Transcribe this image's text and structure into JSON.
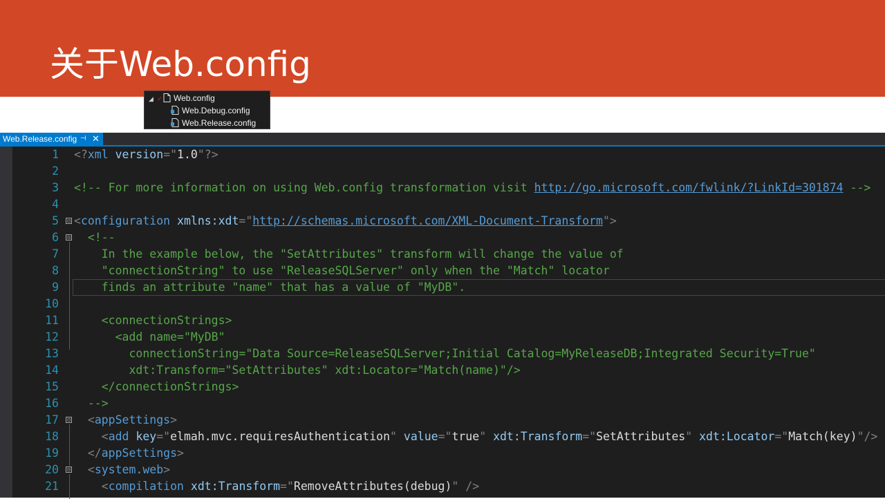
{
  "slide": {
    "title": "关于Web.config"
  },
  "solution_tree": {
    "items": [
      {
        "label": "Web.config",
        "expander": "◢",
        "check": "✓",
        "icon": "config-file-icon"
      },
      {
        "label": "Web.Debug.config",
        "icon": "config-file-icon"
      },
      {
        "label": "Web.Release.config",
        "icon": "config-file-icon"
      }
    ]
  },
  "editor": {
    "tab": {
      "label": "Web.Release.config",
      "pin": "⊣",
      "close": "✕"
    },
    "lines": [
      {
        "n": "1",
        "fold": "",
        "segs": [
          [
            "brk",
            "<?"
          ],
          [
            "tag",
            "xml "
          ],
          [
            "attr",
            "version"
          ],
          [
            "brk",
            "=\""
          ],
          [
            "plain",
            "1.0"
          ],
          [
            "brk",
            "\"?>"
          ]
        ]
      },
      {
        "n": "2",
        "fold": "",
        "segs": []
      },
      {
        "n": "3",
        "fold": "",
        "segs": [
          [
            "com",
            "<!-- For more information on using Web.config transformation visit "
          ],
          [
            "url",
            "http://go.microsoft.com/fwlink/?LinkId=301874"
          ],
          [
            "com",
            " -->"
          ]
        ]
      },
      {
        "n": "4",
        "fold": "",
        "segs": []
      },
      {
        "n": "5",
        "fold": "⊟",
        "segs": [
          [
            "brk",
            "<"
          ],
          [
            "tag",
            "configuration "
          ],
          [
            "attr",
            "xmlns:xdt"
          ],
          [
            "brk",
            "=\""
          ],
          [
            "url",
            "http://schemas.microsoft.com/XML-Document-Transform"
          ],
          [
            "brk",
            "\">"
          ]
        ]
      },
      {
        "n": "6",
        "fold": "⊟",
        "segs": [
          [
            "plain",
            "  "
          ],
          [
            "com",
            "<!--"
          ]
        ]
      },
      {
        "n": "7",
        "fold": "",
        "segs": [
          [
            "com",
            "    In the example below, the \"SetAttributes\" transform will change the value of"
          ]
        ]
      },
      {
        "n": "8",
        "fold": "",
        "segs": [
          [
            "com",
            "    \"connectionString\" to use \"ReleaseSQLServer\" only when the \"Match\" locator"
          ]
        ]
      },
      {
        "n": "9",
        "fold": "",
        "segs": [
          [
            "com",
            "    finds an attribute \"name\" that has a value of \"MyDB\"."
          ]
        ]
      },
      {
        "n": "10",
        "fold": "",
        "segs": []
      },
      {
        "n": "11",
        "fold": "",
        "segs": [
          [
            "com",
            "    <connectionStrings>"
          ]
        ]
      },
      {
        "n": "12",
        "fold": "",
        "segs": [
          [
            "com",
            "      <add name=\"MyDB\""
          ]
        ]
      },
      {
        "n": "13",
        "fold": "",
        "segs": [
          [
            "com",
            "        connectionString=\"Data Source=ReleaseSQLServer;Initial Catalog=MyReleaseDB;Integrated Security=True\""
          ]
        ]
      },
      {
        "n": "14",
        "fold": "",
        "segs": [
          [
            "com",
            "        xdt:Transform=\"SetAttributes\" xdt:Locator=\"Match(name)\"/>"
          ]
        ]
      },
      {
        "n": "15",
        "fold": "",
        "segs": [
          [
            "com",
            "    </connectionStrings>"
          ]
        ]
      },
      {
        "n": "16",
        "fold": "",
        "segs": [
          [
            "com",
            "  -->"
          ]
        ]
      },
      {
        "n": "17",
        "fold": "⊟",
        "segs": [
          [
            "plain",
            "  "
          ],
          [
            "brk",
            "<"
          ],
          [
            "tag",
            "appSettings"
          ],
          [
            "brk",
            ">"
          ]
        ]
      },
      {
        "n": "18",
        "fold": "",
        "segs": [
          [
            "plain",
            "    "
          ],
          [
            "brk",
            "<"
          ],
          [
            "tag",
            "add "
          ],
          [
            "attr",
            "key"
          ],
          [
            "brk",
            "=\""
          ],
          [
            "plain",
            "elmah.mvc.requiresAuthentication"
          ],
          [
            "brk",
            "\" "
          ],
          [
            "attr",
            "value"
          ],
          [
            "brk",
            "=\""
          ],
          [
            "plain",
            "true"
          ],
          [
            "brk",
            "\" "
          ],
          [
            "attr",
            "xdt:Transform"
          ],
          [
            "brk",
            "=\""
          ],
          [
            "plain",
            "SetAttributes"
          ],
          [
            "brk",
            "\" "
          ],
          [
            "attr",
            "xdt:Locator"
          ],
          [
            "brk",
            "=\""
          ],
          [
            "plain",
            "Match(key)"
          ],
          [
            "brk",
            "\"/>"
          ]
        ]
      },
      {
        "n": "19",
        "fold": "",
        "segs": [
          [
            "plain",
            "  "
          ],
          [
            "brk",
            "</"
          ],
          [
            "tag",
            "appSettings"
          ],
          [
            "brk",
            ">"
          ]
        ]
      },
      {
        "n": "20",
        "fold": "⊟",
        "segs": [
          [
            "plain",
            "  "
          ],
          [
            "brk",
            "<"
          ],
          [
            "tag",
            "system.web"
          ],
          [
            "brk",
            ">"
          ]
        ]
      },
      {
        "n": "21",
        "fold": "",
        "segs": [
          [
            "plain",
            "    "
          ],
          [
            "brk",
            "<"
          ],
          [
            "tag",
            "compilation "
          ],
          [
            "attr",
            "xdt:Transform"
          ],
          [
            "brk",
            "=\""
          ],
          [
            "plain",
            "RemoveAttributes(debug)"
          ],
          [
            "brk",
            "\" />"
          ]
        ]
      }
    ]
  },
  "colors": {
    "banner": "#d24726",
    "editor_bg": "#1e1e1e",
    "accent": "#007acc"
  }
}
